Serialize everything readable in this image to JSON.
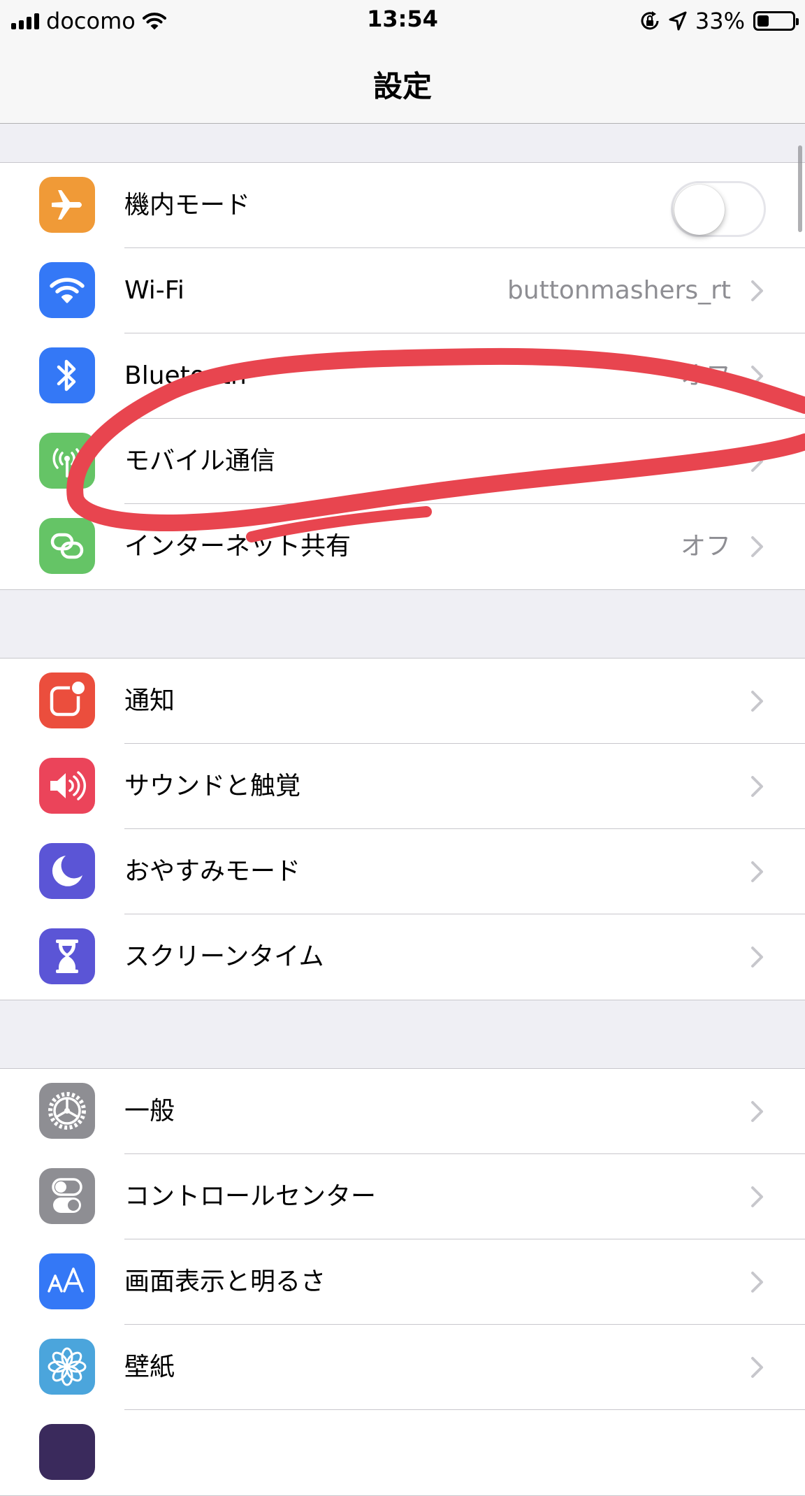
{
  "status_bar": {
    "carrier": "docomo",
    "time": "13:54",
    "battery_percent": "33%",
    "battery_level": 0.33
  },
  "nav": {
    "title": "設定"
  },
  "groups": [
    {
      "rows": [
        {
          "label": "機内モード",
          "icon": "airplane-icon",
          "color": "#f09a37",
          "toggle": false
        },
        {
          "label": "Wi-Fi",
          "value": "buttonmashers_rt",
          "icon": "wifi-icon",
          "color": "#3478f6"
        },
        {
          "label": "Bluetooth",
          "value": "オフ",
          "icon": "bluetooth-icon",
          "color": "#3478f6"
        },
        {
          "label": "モバイル通信",
          "icon": "cellular-icon",
          "color": "#65c466"
        },
        {
          "label": "インターネット共有",
          "value": "オフ",
          "icon": "hotspot-icon",
          "color": "#65c466"
        }
      ]
    },
    {
      "rows": [
        {
          "label": "通知",
          "icon": "notifications-icon",
          "color": "#eb4e3d"
        },
        {
          "label": "サウンドと触覚",
          "icon": "sound-icon",
          "color": "#eb445a"
        },
        {
          "label": "おやすみモード",
          "icon": "moon-icon",
          "color": "#5b55d6"
        },
        {
          "label": "スクリーンタイム",
          "icon": "hourglass-icon",
          "color": "#5b55d6"
        }
      ]
    },
    {
      "rows": [
        {
          "label": "一般",
          "icon": "gear-icon",
          "color": "#8e8e93"
        },
        {
          "label": "コントロールセンター",
          "icon": "switches-icon",
          "color": "#8e8e93"
        },
        {
          "label": "画面表示と明るさ",
          "icon": "text-size-icon",
          "color": "#3478f6"
        },
        {
          "label": "壁紙",
          "icon": "flower-icon",
          "color": "#4ba5dc"
        }
      ]
    }
  ]
}
